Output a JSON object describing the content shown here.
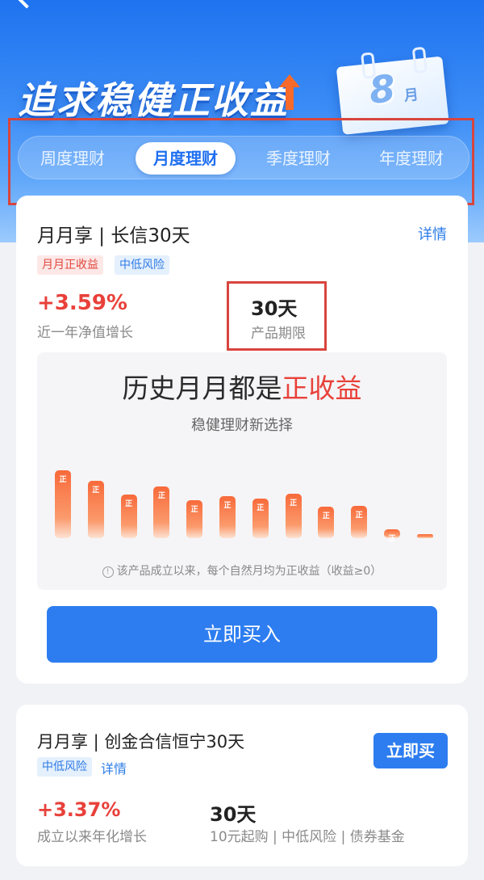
{
  "hero": {
    "title": "追求稳健正收益",
    "calendar_month": "8",
    "calendar_unit": "月"
  },
  "tabs": [
    {
      "label": "周度理财",
      "active": false
    },
    {
      "label": "月度理财",
      "active": true
    },
    {
      "label": "季度理财",
      "active": false
    },
    {
      "label": "年度理财",
      "active": false
    }
  ],
  "product1": {
    "title": "月月享 | 长信30天",
    "detail_link": "详情",
    "tags": [
      "月月正收益",
      "中低风险"
    ],
    "rate": "+3.59%",
    "rate_label": "近一年净值增长",
    "term": "30天",
    "term_label": "产品期限",
    "promo": {
      "title_prefix": "历史月月都是",
      "title_highlight": "正收益",
      "subtitle": "稳健理财新选择",
      "bar_label": "正",
      "bar_levels": [
        1.0,
        0.84,
        0.64,
        0.76,
        0.56,
        0.62,
        0.58,
        0.65,
        0.46,
        0.48,
        0.13,
        0.05
      ],
      "footnote": "该产品成立以来，每个自然月均为正收益（收益≥0）"
    },
    "buy_button": "立即买入"
  },
  "product2": {
    "title": "月月享 | 创金合信恒宁30天",
    "tag": "中低风险",
    "detail_link": "详情",
    "buy_button": "立即买",
    "rate": "+3.37%",
    "rate_label": "成立以来年化增长",
    "term": "30天",
    "term_label": "10元起购 | 中低风险 | 债券基金"
  },
  "colors": {
    "accent_blue": "#2d7df0",
    "positive_red": "#e8413a",
    "highlight_border": "#d8453e"
  }
}
